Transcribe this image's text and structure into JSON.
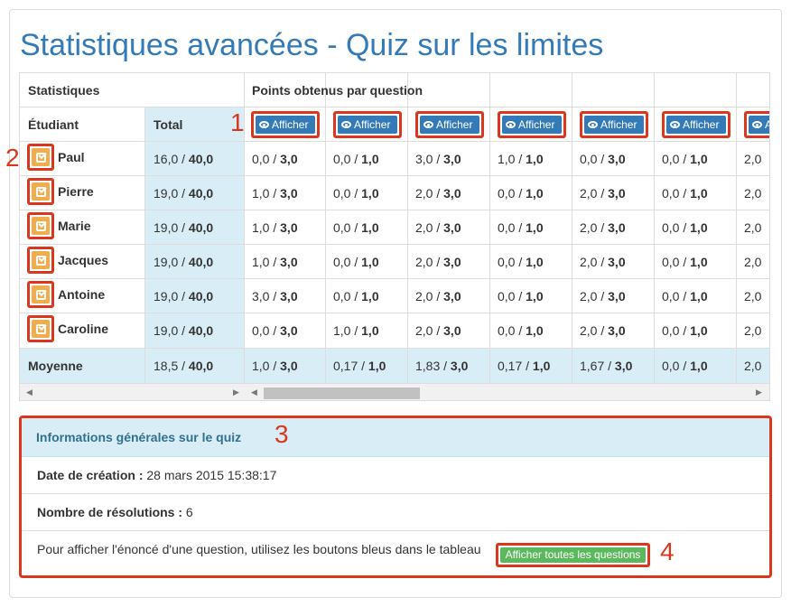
{
  "page": {
    "title": "Statistiques avancées - Quiz sur les limites"
  },
  "table": {
    "group_header_stats": "Statistiques",
    "group_header_points": "Points obtenus par question",
    "col_student": "Étudiant",
    "col_total": "Total",
    "show_button_label": "Afficher",
    "rows": [
      {
        "name": "Paul",
        "total": [
          "16,0",
          "40,0"
        ],
        "scores": [
          [
            "0,0",
            "3,0"
          ],
          [
            "0,0",
            "1,0"
          ],
          [
            "3,0",
            "3,0"
          ],
          [
            "1,0",
            "1,0"
          ],
          [
            "0,0",
            "3,0"
          ],
          [
            "0,0",
            "1,0"
          ],
          [
            "2,0",
            ""
          ]
        ]
      },
      {
        "name": "Pierre",
        "total": [
          "19,0",
          "40,0"
        ],
        "scores": [
          [
            "1,0",
            "3,0"
          ],
          [
            "0,0",
            "1,0"
          ],
          [
            "2,0",
            "3,0"
          ],
          [
            "0,0",
            "1,0"
          ],
          [
            "2,0",
            "3,0"
          ],
          [
            "0,0",
            "1,0"
          ],
          [
            "2,0",
            ""
          ]
        ]
      },
      {
        "name": "Marie",
        "total": [
          "19,0",
          "40,0"
        ],
        "scores": [
          [
            "1,0",
            "3,0"
          ],
          [
            "0,0",
            "1,0"
          ],
          [
            "2,0",
            "3,0"
          ],
          [
            "0,0",
            "1,0"
          ],
          [
            "2,0",
            "3,0"
          ],
          [
            "0,0",
            "1,0"
          ],
          [
            "2,0",
            ""
          ]
        ]
      },
      {
        "name": "Jacques",
        "total": [
          "19,0",
          "40,0"
        ],
        "scores": [
          [
            "1,0",
            "3,0"
          ],
          [
            "0,0",
            "1,0"
          ],
          [
            "2,0",
            "3,0"
          ],
          [
            "0,0",
            "1,0"
          ],
          [
            "2,0",
            "3,0"
          ],
          [
            "0,0",
            "1,0"
          ],
          [
            "2,0",
            ""
          ]
        ]
      },
      {
        "name": "Antoine",
        "total": [
          "19,0",
          "40,0"
        ],
        "scores": [
          [
            "3,0",
            "3,0"
          ],
          [
            "0,0",
            "1,0"
          ],
          [
            "2,0",
            "3,0"
          ],
          [
            "0,0",
            "1,0"
          ],
          [
            "2,0",
            "3,0"
          ],
          [
            "0,0",
            "1,0"
          ],
          [
            "2,0",
            ""
          ]
        ]
      },
      {
        "name": "Caroline",
        "total": [
          "19,0",
          "40,0"
        ],
        "scores": [
          [
            "0,0",
            "3,0"
          ],
          [
            "1,0",
            "1,0"
          ],
          [
            "2,0",
            "3,0"
          ],
          [
            "0,0",
            "1,0"
          ],
          [
            "2,0",
            "3,0"
          ],
          [
            "0,0",
            "1,0"
          ],
          [
            "2,0",
            ""
          ]
        ]
      }
    ],
    "average": {
      "label": "Moyenne",
      "total": [
        "18,5",
        "40,0"
      ],
      "scores": [
        [
          "1,0",
          "3,0"
        ],
        [
          "0,17",
          "1,0"
        ],
        [
          "1,83",
          "3,0"
        ],
        [
          "0,17",
          "1,0"
        ],
        [
          "1,67",
          "3,0"
        ],
        [
          "0,0",
          "1,0"
        ],
        [
          "2,0",
          ""
        ]
      ]
    }
  },
  "info": {
    "header": "Informations générales sur le quiz",
    "created_label": "Date de création :",
    "created_value": "28 mars 2015 15:38:17",
    "resolutions_label": "Nombre de résolutions :",
    "resolutions_value": "6",
    "hint": "Pour afficher l'énoncé d'une question, utilisez les boutons bleus dans le tableau",
    "show_all_button": "Afficher toutes les questions"
  },
  "callouts": [
    "1",
    "2",
    "3",
    "4"
  ],
  "colors": {
    "accent": "#337ab7",
    "highlight": "#d9381e",
    "info_bg": "#d9edf7",
    "warning": "#f0ad4e",
    "success": "#5cb85c"
  }
}
